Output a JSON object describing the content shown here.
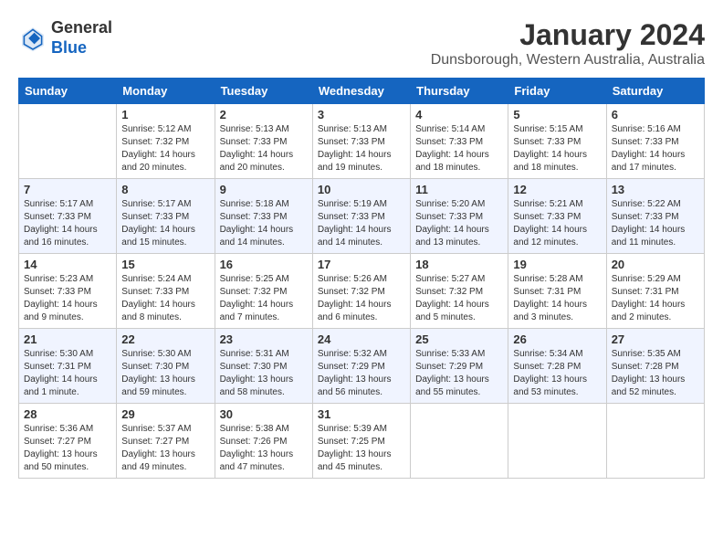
{
  "logo": {
    "text_general": "General",
    "text_blue": "Blue"
  },
  "header": {
    "month_year": "January 2024",
    "location": "Dunsborough, Western Australia, Australia"
  },
  "days_of_week": [
    "Sunday",
    "Monday",
    "Tuesday",
    "Wednesday",
    "Thursday",
    "Friday",
    "Saturday"
  ],
  "weeks": [
    [
      {
        "day": "",
        "info": ""
      },
      {
        "day": "1",
        "info": "Sunrise: 5:12 AM\nSunset: 7:32 PM\nDaylight: 14 hours\nand 20 minutes."
      },
      {
        "day": "2",
        "info": "Sunrise: 5:13 AM\nSunset: 7:33 PM\nDaylight: 14 hours\nand 20 minutes."
      },
      {
        "day": "3",
        "info": "Sunrise: 5:13 AM\nSunset: 7:33 PM\nDaylight: 14 hours\nand 19 minutes."
      },
      {
        "day": "4",
        "info": "Sunrise: 5:14 AM\nSunset: 7:33 PM\nDaylight: 14 hours\nand 18 minutes."
      },
      {
        "day": "5",
        "info": "Sunrise: 5:15 AM\nSunset: 7:33 PM\nDaylight: 14 hours\nand 18 minutes."
      },
      {
        "day": "6",
        "info": "Sunrise: 5:16 AM\nSunset: 7:33 PM\nDaylight: 14 hours\nand 17 minutes."
      }
    ],
    [
      {
        "day": "7",
        "info": "Sunrise: 5:17 AM\nSunset: 7:33 PM\nDaylight: 14 hours\nand 16 minutes."
      },
      {
        "day": "8",
        "info": "Sunrise: 5:17 AM\nSunset: 7:33 PM\nDaylight: 14 hours\nand 15 minutes."
      },
      {
        "day": "9",
        "info": "Sunrise: 5:18 AM\nSunset: 7:33 PM\nDaylight: 14 hours\nand 14 minutes."
      },
      {
        "day": "10",
        "info": "Sunrise: 5:19 AM\nSunset: 7:33 PM\nDaylight: 14 hours\nand 14 minutes."
      },
      {
        "day": "11",
        "info": "Sunrise: 5:20 AM\nSunset: 7:33 PM\nDaylight: 14 hours\nand 13 minutes."
      },
      {
        "day": "12",
        "info": "Sunrise: 5:21 AM\nSunset: 7:33 PM\nDaylight: 14 hours\nand 12 minutes."
      },
      {
        "day": "13",
        "info": "Sunrise: 5:22 AM\nSunset: 7:33 PM\nDaylight: 14 hours\nand 11 minutes."
      }
    ],
    [
      {
        "day": "14",
        "info": "Sunrise: 5:23 AM\nSunset: 7:33 PM\nDaylight: 14 hours\nand 9 minutes."
      },
      {
        "day": "15",
        "info": "Sunrise: 5:24 AM\nSunset: 7:33 PM\nDaylight: 14 hours\nand 8 minutes."
      },
      {
        "day": "16",
        "info": "Sunrise: 5:25 AM\nSunset: 7:32 PM\nDaylight: 14 hours\nand 7 minutes."
      },
      {
        "day": "17",
        "info": "Sunrise: 5:26 AM\nSunset: 7:32 PM\nDaylight: 14 hours\nand 6 minutes."
      },
      {
        "day": "18",
        "info": "Sunrise: 5:27 AM\nSunset: 7:32 PM\nDaylight: 14 hours\nand 5 minutes."
      },
      {
        "day": "19",
        "info": "Sunrise: 5:28 AM\nSunset: 7:31 PM\nDaylight: 14 hours\nand 3 minutes."
      },
      {
        "day": "20",
        "info": "Sunrise: 5:29 AM\nSunset: 7:31 PM\nDaylight: 14 hours\nand 2 minutes."
      }
    ],
    [
      {
        "day": "21",
        "info": "Sunrise: 5:30 AM\nSunset: 7:31 PM\nDaylight: 14 hours\nand 1 minute."
      },
      {
        "day": "22",
        "info": "Sunrise: 5:30 AM\nSunset: 7:30 PM\nDaylight: 13 hours\nand 59 minutes."
      },
      {
        "day": "23",
        "info": "Sunrise: 5:31 AM\nSunset: 7:30 PM\nDaylight: 13 hours\nand 58 minutes."
      },
      {
        "day": "24",
        "info": "Sunrise: 5:32 AM\nSunset: 7:29 PM\nDaylight: 13 hours\nand 56 minutes."
      },
      {
        "day": "25",
        "info": "Sunrise: 5:33 AM\nSunset: 7:29 PM\nDaylight: 13 hours\nand 55 minutes."
      },
      {
        "day": "26",
        "info": "Sunrise: 5:34 AM\nSunset: 7:28 PM\nDaylight: 13 hours\nand 53 minutes."
      },
      {
        "day": "27",
        "info": "Sunrise: 5:35 AM\nSunset: 7:28 PM\nDaylight: 13 hours\nand 52 minutes."
      }
    ],
    [
      {
        "day": "28",
        "info": "Sunrise: 5:36 AM\nSunset: 7:27 PM\nDaylight: 13 hours\nand 50 minutes."
      },
      {
        "day": "29",
        "info": "Sunrise: 5:37 AM\nSunset: 7:27 PM\nDaylight: 13 hours\nand 49 minutes."
      },
      {
        "day": "30",
        "info": "Sunrise: 5:38 AM\nSunset: 7:26 PM\nDaylight: 13 hours\nand 47 minutes."
      },
      {
        "day": "31",
        "info": "Sunrise: 5:39 AM\nSunset: 7:25 PM\nDaylight: 13 hours\nand 45 minutes."
      },
      {
        "day": "",
        "info": ""
      },
      {
        "day": "",
        "info": ""
      },
      {
        "day": "",
        "info": ""
      }
    ]
  ]
}
